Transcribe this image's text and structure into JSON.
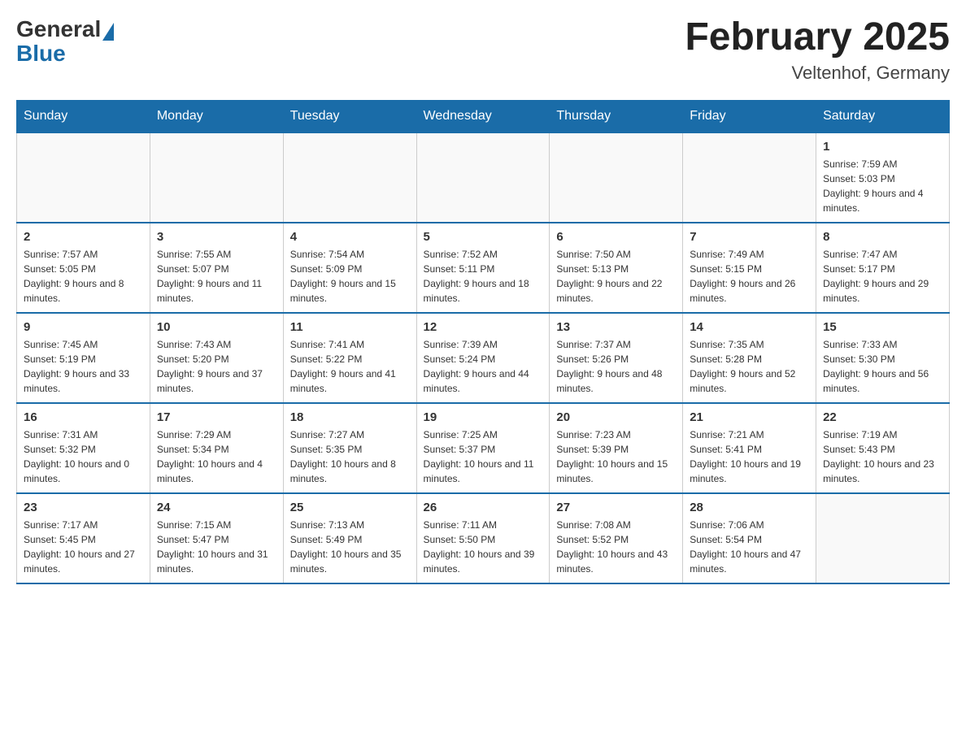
{
  "header": {
    "logo_general": "General",
    "logo_blue": "Blue",
    "month_title": "February 2025",
    "location": "Veltenhof, Germany"
  },
  "weekdays": [
    "Sunday",
    "Monday",
    "Tuesday",
    "Wednesday",
    "Thursday",
    "Friday",
    "Saturday"
  ],
  "weeks": [
    {
      "days": [
        {
          "num": "",
          "info": ""
        },
        {
          "num": "",
          "info": ""
        },
        {
          "num": "",
          "info": ""
        },
        {
          "num": "",
          "info": ""
        },
        {
          "num": "",
          "info": ""
        },
        {
          "num": "",
          "info": ""
        },
        {
          "num": "1",
          "info": "Sunrise: 7:59 AM\nSunset: 5:03 PM\nDaylight: 9 hours and 4 minutes."
        }
      ]
    },
    {
      "days": [
        {
          "num": "2",
          "info": "Sunrise: 7:57 AM\nSunset: 5:05 PM\nDaylight: 9 hours and 8 minutes."
        },
        {
          "num": "3",
          "info": "Sunrise: 7:55 AM\nSunset: 5:07 PM\nDaylight: 9 hours and 11 minutes."
        },
        {
          "num": "4",
          "info": "Sunrise: 7:54 AM\nSunset: 5:09 PM\nDaylight: 9 hours and 15 minutes."
        },
        {
          "num": "5",
          "info": "Sunrise: 7:52 AM\nSunset: 5:11 PM\nDaylight: 9 hours and 18 minutes."
        },
        {
          "num": "6",
          "info": "Sunrise: 7:50 AM\nSunset: 5:13 PM\nDaylight: 9 hours and 22 minutes."
        },
        {
          "num": "7",
          "info": "Sunrise: 7:49 AM\nSunset: 5:15 PM\nDaylight: 9 hours and 26 minutes."
        },
        {
          "num": "8",
          "info": "Sunrise: 7:47 AM\nSunset: 5:17 PM\nDaylight: 9 hours and 29 minutes."
        }
      ]
    },
    {
      "days": [
        {
          "num": "9",
          "info": "Sunrise: 7:45 AM\nSunset: 5:19 PM\nDaylight: 9 hours and 33 minutes."
        },
        {
          "num": "10",
          "info": "Sunrise: 7:43 AM\nSunset: 5:20 PM\nDaylight: 9 hours and 37 minutes."
        },
        {
          "num": "11",
          "info": "Sunrise: 7:41 AM\nSunset: 5:22 PM\nDaylight: 9 hours and 41 minutes."
        },
        {
          "num": "12",
          "info": "Sunrise: 7:39 AM\nSunset: 5:24 PM\nDaylight: 9 hours and 44 minutes."
        },
        {
          "num": "13",
          "info": "Sunrise: 7:37 AM\nSunset: 5:26 PM\nDaylight: 9 hours and 48 minutes."
        },
        {
          "num": "14",
          "info": "Sunrise: 7:35 AM\nSunset: 5:28 PM\nDaylight: 9 hours and 52 minutes."
        },
        {
          "num": "15",
          "info": "Sunrise: 7:33 AM\nSunset: 5:30 PM\nDaylight: 9 hours and 56 minutes."
        }
      ]
    },
    {
      "days": [
        {
          "num": "16",
          "info": "Sunrise: 7:31 AM\nSunset: 5:32 PM\nDaylight: 10 hours and 0 minutes."
        },
        {
          "num": "17",
          "info": "Sunrise: 7:29 AM\nSunset: 5:34 PM\nDaylight: 10 hours and 4 minutes."
        },
        {
          "num": "18",
          "info": "Sunrise: 7:27 AM\nSunset: 5:35 PM\nDaylight: 10 hours and 8 minutes."
        },
        {
          "num": "19",
          "info": "Sunrise: 7:25 AM\nSunset: 5:37 PM\nDaylight: 10 hours and 11 minutes."
        },
        {
          "num": "20",
          "info": "Sunrise: 7:23 AM\nSunset: 5:39 PM\nDaylight: 10 hours and 15 minutes."
        },
        {
          "num": "21",
          "info": "Sunrise: 7:21 AM\nSunset: 5:41 PM\nDaylight: 10 hours and 19 minutes."
        },
        {
          "num": "22",
          "info": "Sunrise: 7:19 AM\nSunset: 5:43 PM\nDaylight: 10 hours and 23 minutes."
        }
      ]
    },
    {
      "days": [
        {
          "num": "23",
          "info": "Sunrise: 7:17 AM\nSunset: 5:45 PM\nDaylight: 10 hours and 27 minutes."
        },
        {
          "num": "24",
          "info": "Sunrise: 7:15 AM\nSunset: 5:47 PM\nDaylight: 10 hours and 31 minutes."
        },
        {
          "num": "25",
          "info": "Sunrise: 7:13 AM\nSunset: 5:49 PM\nDaylight: 10 hours and 35 minutes."
        },
        {
          "num": "26",
          "info": "Sunrise: 7:11 AM\nSunset: 5:50 PM\nDaylight: 10 hours and 39 minutes."
        },
        {
          "num": "27",
          "info": "Sunrise: 7:08 AM\nSunset: 5:52 PM\nDaylight: 10 hours and 43 minutes."
        },
        {
          "num": "28",
          "info": "Sunrise: 7:06 AM\nSunset: 5:54 PM\nDaylight: 10 hours and 47 minutes."
        },
        {
          "num": "",
          "info": ""
        }
      ]
    }
  ]
}
